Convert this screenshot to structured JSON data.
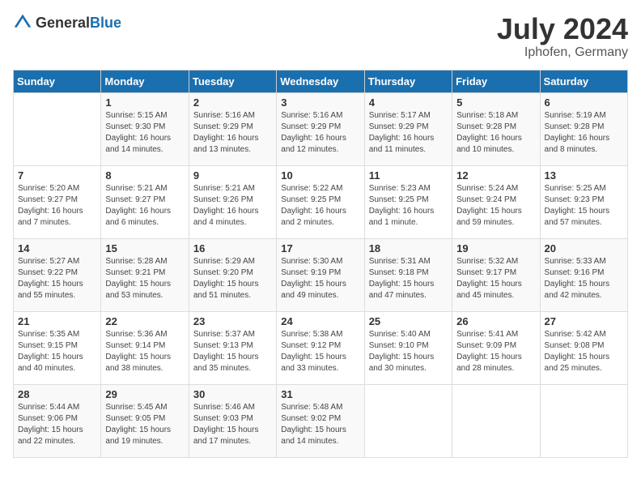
{
  "logo": {
    "text_general": "General",
    "text_blue": "Blue"
  },
  "title": {
    "month_year": "July 2024",
    "location": "Iphofen, Germany"
  },
  "weekdays": [
    "Sunday",
    "Monday",
    "Tuesday",
    "Wednesday",
    "Thursday",
    "Friday",
    "Saturday"
  ],
  "weeks": [
    [
      {
        "day": "",
        "info": ""
      },
      {
        "day": "1",
        "info": "Sunrise: 5:15 AM\nSunset: 9:30 PM\nDaylight: 16 hours\nand 14 minutes."
      },
      {
        "day": "2",
        "info": "Sunrise: 5:16 AM\nSunset: 9:29 PM\nDaylight: 16 hours\nand 13 minutes."
      },
      {
        "day": "3",
        "info": "Sunrise: 5:16 AM\nSunset: 9:29 PM\nDaylight: 16 hours\nand 12 minutes."
      },
      {
        "day": "4",
        "info": "Sunrise: 5:17 AM\nSunset: 9:29 PM\nDaylight: 16 hours\nand 11 minutes."
      },
      {
        "day": "5",
        "info": "Sunrise: 5:18 AM\nSunset: 9:28 PM\nDaylight: 16 hours\nand 10 minutes."
      },
      {
        "day": "6",
        "info": "Sunrise: 5:19 AM\nSunset: 9:28 PM\nDaylight: 16 hours\nand 8 minutes."
      }
    ],
    [
      {
        "day": "7",
        "info": "Sunrise: 5:20 AM\nSunset: 9:27 PM\nDaylight: 16 hours\nand 7 minutes."
      },
      {
        "day": "8",
        "info": "Sunrise: 5:21 AM\nSunset: 9:27 PM\nDaylight: 16 hours\nand 6 minutes."
      },
      {
        "day": "9",
        "info": "Sunrise: 5:21 AM\nSunset: 9:26 PM\nDaylight: 16 hours\nand 4 minutes."
      },
      {
        "day": "10",
        "info": "Sunrise: 5:22 AM\nSunset: 9:25 PM\nDaylight: 16 hours\nand 2 minutes."
      },
      {
        "day": "11",
        "info": "Sunrise: 5:23 AM\nSunset: 9:25 PM\nDaylight: 16 hours\nand 1 minute."
      },
      {
        "day": "12",
        "info": "Sunrise: 5:24 AM\nSunset: 9:24 PM\nDaylight: 15 hours\nand 59 minutes."
      },
      {
        "day": "13",
        "info": "Sunrise: 5:25 AM\nSunset: 9:23 PM\nDaylight: 15 hours\nand 57 minutes."
      }
    ],
    [
      {
        "day": "14",
        "info": "Sunrise: 5:27 AM\nSunset: 9:22 PM\nDaylight: 15 hours\nand 55 minutes."
      },
      {
        "day": "15",
        "info": "Sunrise: 5:28 AM\nSunset: 9:21 PM\nDaylight: 15 hours\nand 53 minutes."
      },
      {
        "day": "16",
        "info": "Sunrise: 5:29 AM\nSunset: 9:20 PM\nDaylight: 15 hours\nand 51 minutes."
      },
      {
        "day": "17",
        "info": "Sunrise: 5:30 AM\nSunset: 9:19 PM\nDaylight: 15 hours\nand 49 minutes."
      },
      {
        "day": "18",
        "info": "Sunrise: 5:31 AM\nSunset: 9:18 PM\nDaylight: 15 hours\nand 47 minutes."
      },
      {
        "day": "19",
        "info": "Sunrise: 5:32 AM\nSunset: 9:17 PM\nDaylight: 15 hours\nand 45 minutes."
      },
      {
        "day": "20",
        "info": "Sunrise: 5:33 AM\nSunset: 9:16 PM\nDaylight: 15 hours\nand 42 minutes."
      }
    ],
    [
      {
        "day": "21",
        "info": "Sunrise: 5:35 AM\nSunset: 9:15 PM\nDaylight: 15 hours\nand 40 minutes."
      },
      {
        "day": "22",
        "info": "Sunrise: 5:36 AM\nSunset: 9:14 PM\nDaylight: 15 hours\nand 38 minutes."
      },
      {
        "day": "23",
        "info": "Sunrise: 5:37 AM\nSunset: 9:13 PM\nDaylight: 15 hours\nand 35 minutes."
      },
      {
        "day": "24",
        "info": "Sunrise: 5:38 AM\nSunset: 9:12 PM\nDaylight: 15 hours\nand 33 minutes."
      },
      {
        "day": "25",
        "info": "Sunrise: 5:40 AM\nSunset: 9:10 PM\nDaylight: 15 hours\nand 30 minutes."
      },
      {
        "day": "26",
        "info": "Sunrise: 5:41 AM\nSunset: 9:09 PM\nDaylight: 15 hours\nand 28 minutes."
      },
      {
        "day": "27",
        "info": "Sunrise: 5:42 AM\nSunset: 9:08 PM\nDaylight: 15 hours\nand 25 minutes."
      }
    ],
    [
      {
        "day": "28",
        "info": "Sunrise: 5:44 AM\nSunset: 9:06 PM\nDaylight: 15 hours\nand 22 minutes."
      },
      {
        "day": "29",
        "info": "Sunrise: 5:45 AM\nSunset: 9:05 PM\nDaylight: 15 hours\nand 19 minutes."
      },
      {
        "day": "30",
        "info": "Sunrise: 5:46 AM\nSunset: 9:03 PM\nDaylight: 15 hours\nand 17 minutes."
      },
      {
        "day": "31",
        "info": "Sunrise: 5:48 AM\nSunset: 9:02 PM\nDaylight: 15 hours\nand 14 minutes."
      },
      {
        "day": "",
        "info": ""
      },
      {
        "day": "",
        "info": ""
      },
      {
        "day": "",
        "info": ""
      }
    ]
  ]
}
